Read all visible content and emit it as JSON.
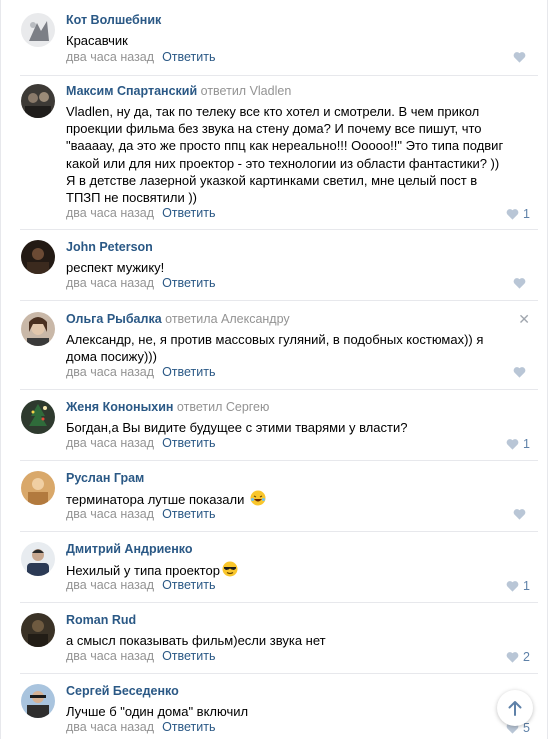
{
  "comments": [
    {
      "author": "Кот Волшебник",
      "reply_to": "",
      "text": "Красавчик",
      "time": "два часа назад",
      "reply_label": "Ответить",
      "likes": ""
    },
    {
      "author": "Максим Спартанский",
      "reply_to": "ответил Vladlen",
      "text": "Vladlen, ну да, так по телеку все кто хотел и смотрели. В чем прикол проекции фильма без звука на стену дома? И почему все пишут, что \"ваааау, да это же просто ппц как нереально!!! Оoooo!!\" Это типа подвиг какой или для них проектор - это технологии из области фантастики? )) Я в детстве лазерной указкой картинками светил, мне целый пост в ТПЗП не посвятили ))",
      "time": "два часа назад",
      "reply_label": "Ответить",
      "likes": "1"
    },
    {
      "author": "John Peterson",
      "reply_to": "",
      "text": "респект мужику!",
      "time": "два часа назад",
      "reply_label": "Ответить",
      "likes": ""
    },
    {
      "author": "Ольга Рыбалка",
      "reply_to": "ответила Александру",
      "text": "Александр, не, я против массовых гуляний, в подобных костюмах)) я дома посижу)))",
      "time": "два часа назад",
      "reply_label": "Ответить",
      "likes": ""
    },
    {
      "author": "Женя Кононыхин",
      "reply_to": "ответил Сергею",
      "text": "Богдан,а Вы видите будущее с этими тварями у власти?",
      "time": "два часа назад",
      "reply_label": "Ответить",
      "likes": "1"
    },
    {
      "author": "Руслан Грам",
      "reply_to": "",
      "text": "терминатора лутше показали",
      "time": "два часа назад",
      "reply_label": "Ответить",
      "likes": ""
    },
    {
      "author": "Дмитрий Андриенко",
      "reply_to": "",
      "text": "Нехилый у типа проектор",
      "time": "два часа назад",
      "reply_label": "Ответить",
      "likes": "1"
    },
    {
      "author": "Roman Rud",
      "reply_to": "",
      "text": "а смысл показывать фильм)если звука нет",
      "time": "два часа назад",
      "reply_label": "Ответить",
      "likes": "2"
    },
    {
      "author": "Сергей Беседенко",
      "reply_to": "",
      "text": "Лучше б \"один дома\" включил",
      "time": "два часа назад",
      "reply_label": "Ответить",
      "likes": "5"
    }
  ],
  "colors": {
    "link": "#2a5885",
    "muted": "#939393",
    "like": "#5e81a8",
    "divider": "#e7e8ec"
  },
  "icons": {
    "like": "heart-icon",
    "close": "close-icon",
    "scroll_top": "arrow-up-icon",
    "laughing": "laughing-emoji-icon",
    "cool": "sunglasses-emoji-icon"
  }
}
